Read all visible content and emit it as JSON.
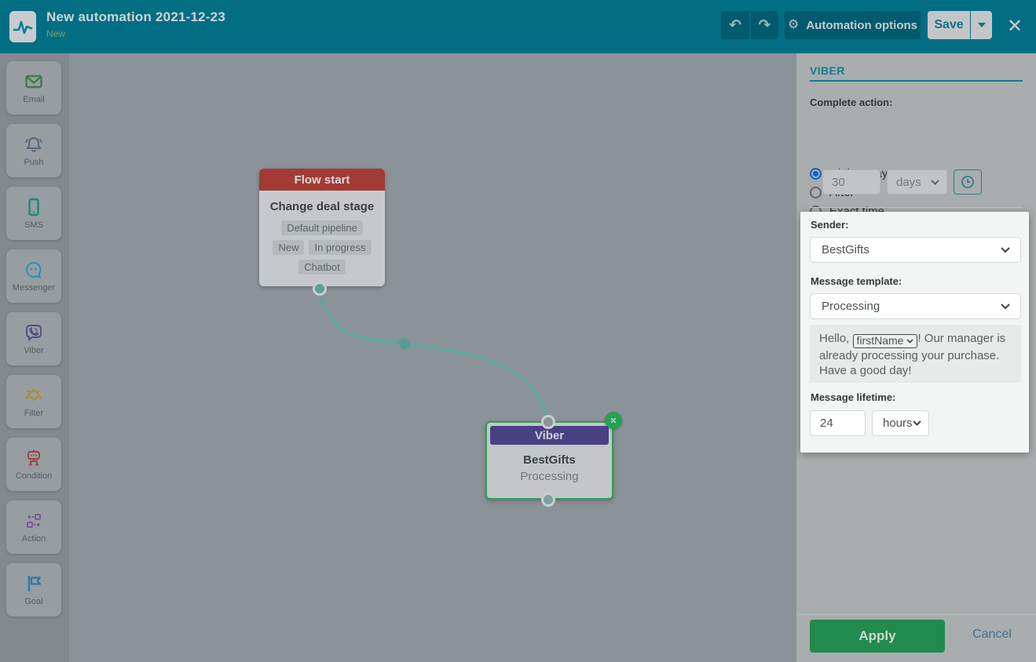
{
  "colors": {
    "header_teal": "#016e84",
    "header_button_teal": "#015a6e",
    "panel_heading_teal": "#0d7e95",
    "apply_green": "#218a4d",
    "flow_start_red": "#a33b34",
    "viber_purple": "#4a4184",
    "selected_node_green": "#2e9e53",
    "radio_selected_blue": "#1262c5",
    "edge_teal": "#68a29c",
    "canvas_gray": "#8c9398",
    "spotlight_white": "#f3f5f4"
  },
  "header": {
    "title": "New automation 2021-12-23",
    "subtitle": "New",
    "undo_glyph": "↶",
    "redo_glyph": "↷",
    "gear_glyph": "⚙",
    "automation_options_label": "Automation options",
    "save_label": "Save",
    "close_glyph": "✕"
  },
  "sidebar": {
    "items": [
      {
        "label": "Email"
      },
      {
        "label": "Push"
      },
      {
        "label": "SMS"
      },
      {
        "label": "Messenger"
      },
      {
        "label": "Viber"
      },
      {
        "label": "Filter"
      },
      {
        "label": "Condition"
      },
      {
        "label": "Action"
      },
      {
        "label": "Goal"
      }
    ]
  },
  "canvas": {
    "flow_start": {
      "header": "Flow start",
      "title": "Change deal stage",
      "tags": [
        "Default pipeline",
        "New",
        "In progress",
        "Chatbot"
      ]
    },
    "viber_node": {
      "header": "Viber",
      "line1": "BestGifts",
      "line2": "Processing",
      "close_glyph": "✕"
    }
  },
  "panel": {
    "heading": "VIBER",
    "complete_action_label": "Complete action:",
    "radios": [
      {
        "label": "Right away",
        "selected": true
      },
      {
        "label": "After",
        "selected": false
      },
      {
        "label": "Exact time",
        "selected": false
      }
    ],
    "delay_value": "30",
    "delay_unit": "days",
    "sender_label": "Sender:",
    "sender_value": "BestGifts",
    "template_label": "Message template:",
    "template_value": "Processing",
    "preview": {
      "text_before": "Hello, ",
      "variable": "firstName",
      "text_after": "! Our manager is already processing your purchase. Have a good day!"
    },
    "lifetime_label": "Message lifetime:",
    "lifetime_value": "24",
    "lifetime_unit": "hours",
    "apply_label": "Apply",
    "cancel_label": "Cancel"
  }
}
